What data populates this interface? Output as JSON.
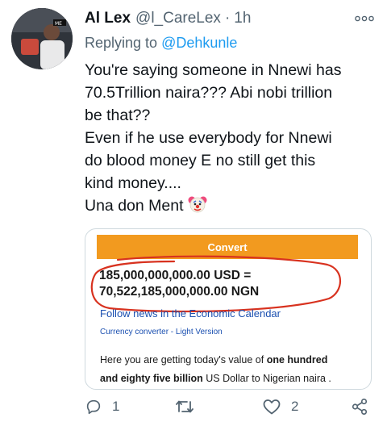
{
  "tweet": {
    "display_name": "Al Lex",
    "handle": "@l_CareLex",
    "separator": "·",
    "time": "1h",
    "reply_prefix": "Replying to",
    "reply_to": "@Dehkunle",
    "lines": [
      "You're saying someone in Nnewi has",
      "70.5Trillion naira??? Abi nobi trillion",
      "be that??",
      "Even if he use everybody for Nnewi",
      "do blood money E no still get this",
      "kind money....",
      "Una don Ment"
    ],
    "emoji_icon": "clown-face-icon"
  },
  "media": {
    "convert_label": "Convert",
    "result_line_1": "185,000,000,000.00 USD =",
    "result_line_2": "70,522,185,000,000.00 NGN",
    "follow_link": "Follow news in the Economic Calendar",
    "converter_link": "Currency converter - Light Version",
    "desc_line_1_pre": "Here you are getting today's value of ",
    "desc_line_1_bold": "one hundred",
    "desc_line_2_bold": "and eighty five billion",
    "desc_line_2_post": " US Dollar to Nigerian naira .",
    "button_color": "#f29a1f",
    "circle_color": "#d8321f"
  },
  "actions": {
    "reply_count": "1",
    "retweet_count": "",
    "like_count": "2",
    "icons": [
      "reply-icon",
      "retweet-icon",
      "like-icon",
      "share-icon"
    ]
  },
  "colors": {
    "text": "#0f1419",
    "muted": "#536471",
    "link": "#1d9bf0"
  }
}
